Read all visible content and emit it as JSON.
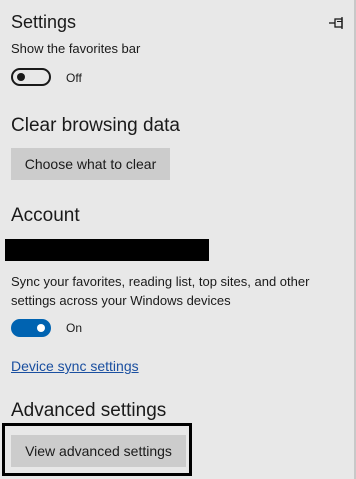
{
  "header": {
    "title": "Settings",
    "pin_icon": "pin-icon"
  },
  "favorites_bar": {
    "label": "Show the favorites bar",
    "toggle_state": "Off"
  },
  "clear_browsing": {
    "heading": "Clear browsing data",
    "button_label": "Choose what to clear"
  },
  "account": {
    "heading": "Account",
    "sync_description": "Sync your favorites, reading list, top sites, and other settings across your Windows devices",
    "toggle_state": "On",
    "sync_link": "Device sync settings"
  },
  "advanced": {
    "heading": "Advanced settings",
    "button_label": "View advanced settings"
  },
  "colors": {
    "background": "#e8e8e8",
    "accent": "#0063b1",
    "link": "#1a4fa0",
    "button": "#cccccc"
  }
}
